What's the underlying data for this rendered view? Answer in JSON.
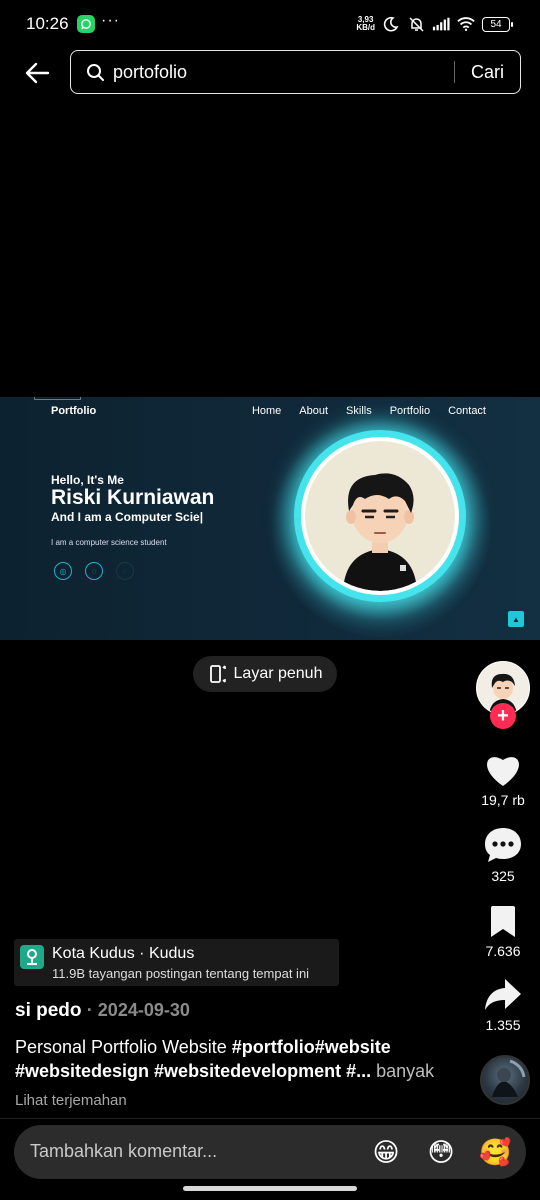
{
  "status_bar": {
    "time": "10:26",
    "speed_value": "3,93",
    "speed_unit": "KB/d",
    "battery": "54",
    "icons": [
      "whatsapp-icon",
      "more-dots-icon",
      "moon-icon",
      "bell-off-icon",
      "signal-icon",
      "wifi-icon",
      "battery-icon"
    ]
  },
  "search": {
    "query": "portofolio",
    "submit_label": "Cari"
  },
  "video": {
    "site_brand": "Portfolio",
    "nav": [
      "Home",
      "About",
      "Skills",
      "Portfolio",
      "Contact"
    ],
    "greeting": "Hello, It's Me",
    "name": "Riski Kurniawan",
    "role": "And I am a Computer Scie|",
    "description": "I am a computer science student",
    "accent_color": "#45e4ec",
    "background_color": "#0f2736"
  },
  "fullscreen_label": "Layar penuh",
  "actions": {
    "likes": "19,7 rb",
    "comments": "325",
    "saves": "7.636",
    "shares": "1.355",
    "like_color": "#ffffff",
    "follow_color": "#fe2c55"
  },
  "location": {
    "title": "Kota Kudus · Kudus",
    "subtitle": "11.9B tayangan postingan tentang tempat ini"
  },
  "post": {
    "author": "si pedo",
    "date": "· 2024-09-30",
    "caption_text": "Personal Portfolio Website ",
    "caption_tags_line1": "#portfolio#website",
    "caption_tags_line2": "#websitedesign #websitedevelopment #...",
    "more_label": "banyak",
    "translate_label": "Lihat terjemahan"
  },
  "comment": {
    "placeholder": "Tambahkan komentar...",
    "emojis": [
      "😁",
      "😳",
      "🥰"
    ]
  }
}
